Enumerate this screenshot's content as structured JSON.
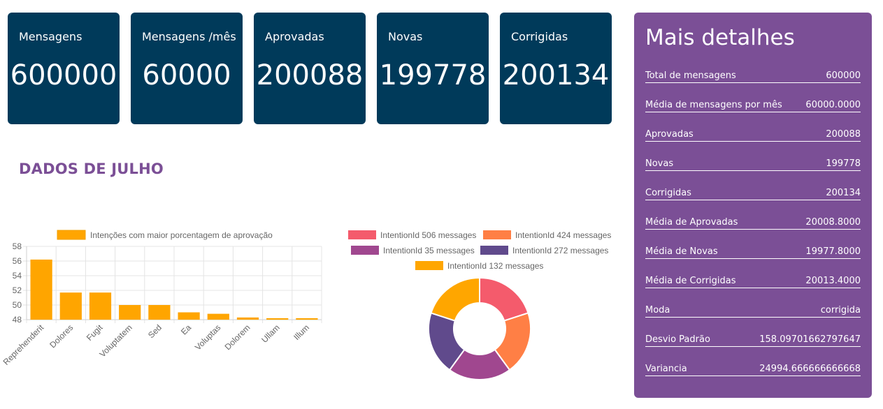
{
  "cards": [
    {
      "label": "Mensagens",
      "value": "600000"
    },
    {
      "label": "Mensagens /mês",
      "value": "60000"
    },
    {
      "label": "Aprovadas",
      "value": "200088"
    },
    {
      "label": "Novas",
      "value": "199778"
    },
    {
      "label": "Corrigidas",
      "value": "200134"
    }
  ],
  "section_title": "DADOS DE JULHO",
  "details": {
    "title": "Mais detalhes",
    "rows": [
      {
        "label": "Total de mensagens",
        "value": "600000"
      },
      {
        "label": "Média de mensagens por mês",
        "value": "60000.0000"
      },
      {
        "label": "Aprovadas",
        "value": "200088"
      },
      {
        "label": "Novas",
        "value": "199778"
      },
      {
        "label": "Corrigidas",
        "value": "200134"
      },
      {
        "label": "Média de Aprovadas",
        "value": "20008.8000"
      },
      {
        "label": "Média de Novas",
        "value": "19977.8000"
      },
      {
        "label": "Média de Corrigidas",
        "value": "20013.4000"
      },
      {
        "label": "Moda",
        "value": "corrigida"
      },
      {
        "label": "Desvio Padrão",
        "value": "158.09701662797647"
      },
      {
        "label": "Variancia",
        "value": "24994.666666666668"
      }
    ]
  },
  "chart_data": [
    {
      "type": "bar",
      "categories": [
        "Reprehenderit",
        "Dolores",
        "Fugit",
        "Voluptatem",
        "Sed",
        "Ea",
        "Voluptas",
        "Dolorem",
        "Ullam",
        "Illum"
      ],
      "series": [
        {
          "name": "Intenções com maior porcentagem de aprovação",
          "values": [
            56.2,
            51.7,
            51.7,
            50.0,
            50.0,
            49.0,
            48.8,
            48.3,
            48.2,
            48.2
          ],
          "color": "#ffa500"
        }
      ],
      "ylim": [
        48,
        58
      ],
      "yticks": [
        48,
        50,
        52,
        54,
        56,
        58
      ],
      "grid": true,
      "legend": "top"
    },
    {
      "type": "pie",
      "labels": [
        "IntentionId 506 messages",
        "IntentionId 424 messages",
        "IntentionId 35 messages",
        "IntentionId 272 messages",
        "IntentionId 132 messages"
      ],
      "values": [
        20,
        20,
        20,
        20,
        20
      ],
      "colors": [
        "#f45b6c",
        "#ff7f45",
        "#a0478f",
        "#604a8c",
        "#ffa600"
      ],
      "legend": "top"
    }
  ]
}
